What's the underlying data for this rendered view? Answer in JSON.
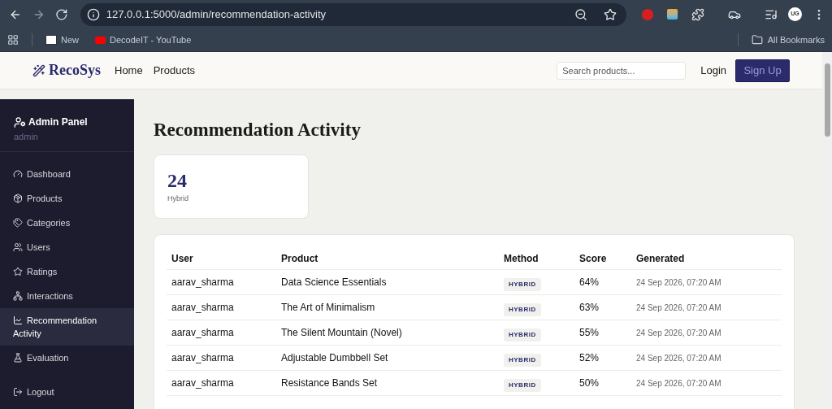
{
  "browser": {
    "url": "127.0.0.1:5000/admin/recommendation-activity",
    "bookmarks": [
      {
        "label": "New"
      },
      {
        "label": "DecodeIT - YouTube"
      }
    ],
    "all_bookmarks": "All Bookmarks",
    "profile": "UG"
  },
  "navbar": {
    "logo": "RecoSys",
    "links": [
      "Home",
      "Products"
    ],
    "search": {
      "placeholder": "Search products..."
    },
    "login": "Login",
    "signup": "Sign Up"
  },
  "sidebar": {
    "title": "Admin Panel",
    "subtitle": "admin",
    "items": [
      {
        "label": "Dashboard",
        "selected": false
      },
      {
        "label": "Products",
        "selected": false
      },
      {
        "label": "Categories",
        "selected": false
      },
      {
        "label": "Users",
        "selected": false
      },
      {
        "label": "Ratings",
        "selected": false
      },
      {
        "label": "Interactions",
        "selected": false
      },
      {
        "label": "Recommendation Activity",
        "selected": true
      },
      {
        "label": "Evaluation",
        "selected": false
      }
    ],
    "logout": "Logout"
  },
  "page": {
    "title": "Recommendation Activity",
    "stat": {
      "value": "24",
      "label": "Hybrid"
    }
  },
  "table": {
    "columns": [
      "User",
      "Product",
      "Method",
      "Score",
      "Generated"
    ],
    "rows": [
      {
        "user": "aarav_sharma",
        "product": "Data Science Essentials",
        "method": "HYBRID",
        "score": "64%",
        "generated": "24 Sep 2026, 07:20 AM"
      },
      {
        "user": "aarav_sharma",
        "product": "The Art of Minimalism",
        "method": "HYBRID",
        "score": "63%",
        "generated": "24 Sep 2026, 07:20 AM"
      },
      {
        "user": "aarav_sharma",
        "product": "The Silent Mountain (Novel)",
        "method": "HYBRID",
        "score": "55%",
        "generated": "24 Sep 2026, 07:20 AM"
      },
      {
        "user": "aarav_sharma",
        "product": "Adjustable Dumbbell Set",
        "method": "HYBRID",
        "score": "52%",
        "generated": "24 Sep 2026, 07:20 AM"
      },
      {
        "user": "aarav_sharma",
        "product": "Resistance Bands Set",
        "method": "HYBRID",
        "score": "50%",
        "generated": "24 Sep 2026, 07:20 AM"
      }
    ]
  }
}
